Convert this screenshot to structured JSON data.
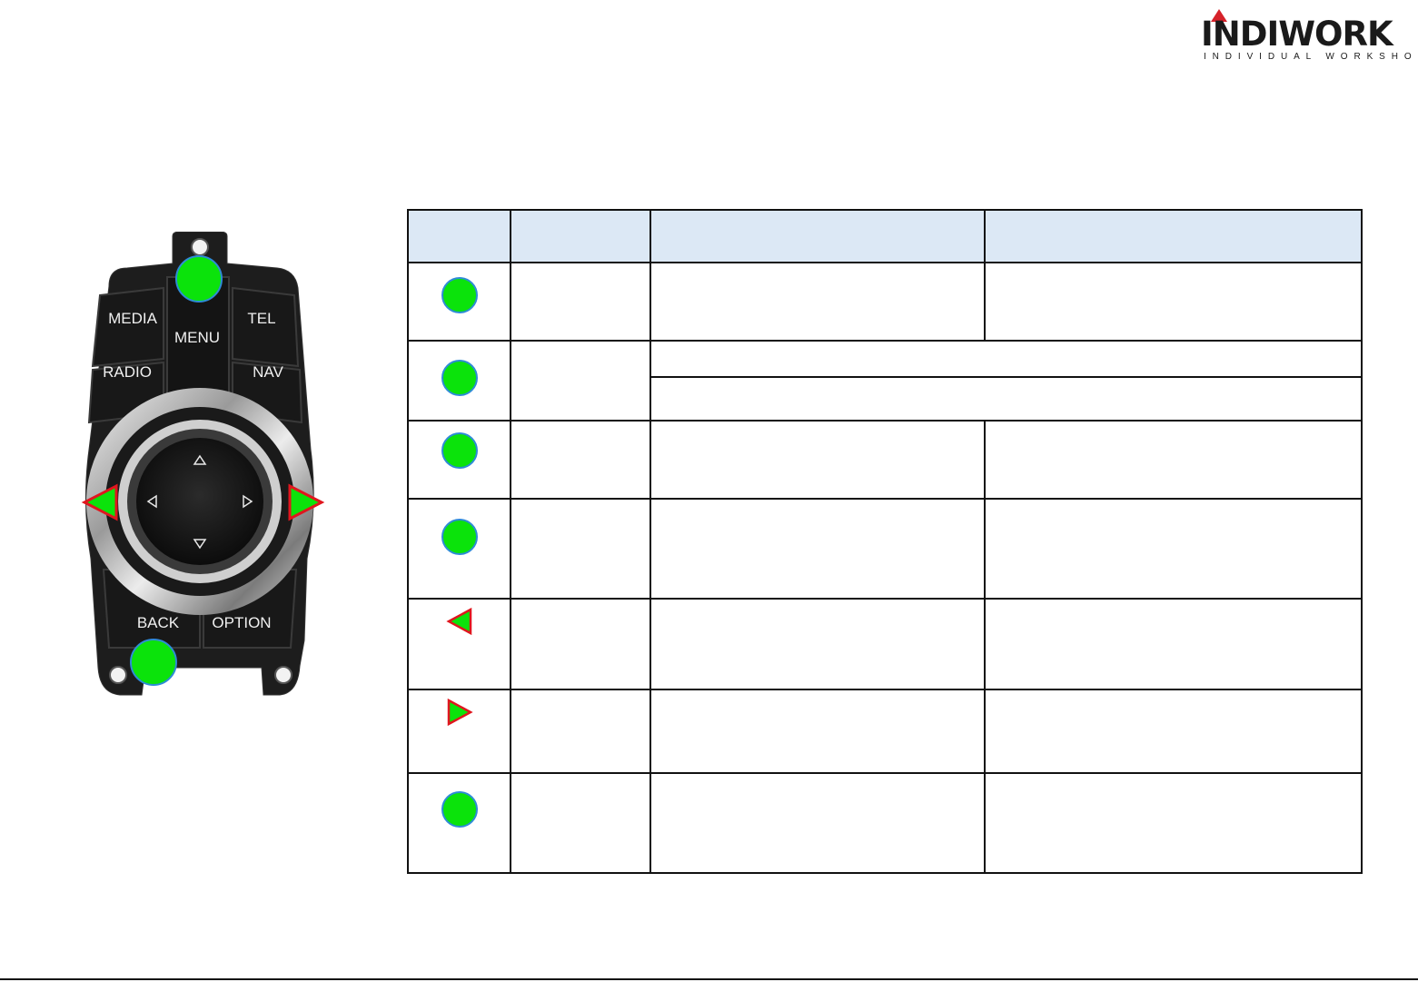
{
  "logo": {
    "name": "INDIWORK",
    "tagline": "INDIVIDUAL WORKSHOP"
  },
  "controller": {
    "buttons": {
      "media": "MEDIA",
      "menu": "MENU",
      "tel": "TEL",
      "radio": "RADIO",
      "nav": "NAV",
      "back": "BACK",
      "option": "OPTION"
    }
  },
  "table": {
    "headers": [
      "",
      "",
      "",
      ""
    ],
    "rows": [
      {
        "marker": "green-dot",
        "cols": [
          "",
          "",
          ""
        ]
      },
      {
        "marker": "green-dot",
        "cols": [
          "",
          "",
          ""
        ]
      },
      {
        "marker": "green-dot",
        "cols": [
          "",
          "",
          ""
        ]
      },
      {
        "marker": "green-dot",
        "cols": [
          "",
          "",
          ""
        ]
      },
      {
        "marker": "left-triangle",
        "cols": [
          "",
          "",
          ""
        ]
      },
      {
        "marker": "right-triangle",
        "cols": [
          "",
          "",
          ""
        ]
      },
      {
        "marker": "green-dot",
        "cols": [
          "",
          "",
          ""
        ]
      }
    ]
  },
  "colors": {
    "marker_green": "#0be30b",
    "marker_outline_blue": "#2e8bd6",
    "marker_outline_red": "#e0161e",
    "header_bg": "#dce8f5"
  }
}
